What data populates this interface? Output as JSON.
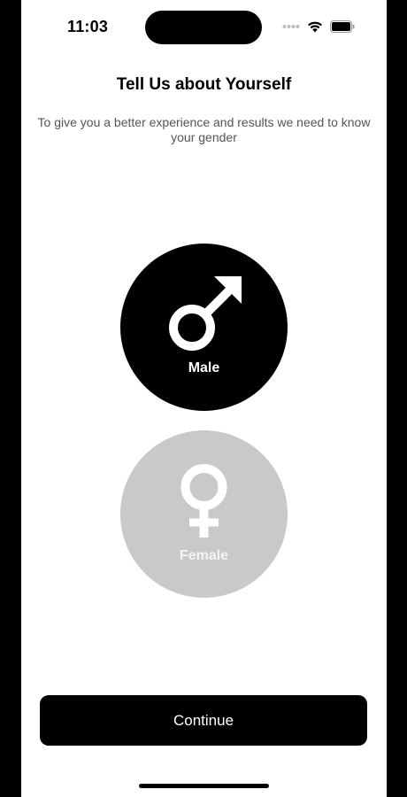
{
  "status_bar": {
    "time": "11:03",
    "icons": [
      "signal-dots-icon",
      "wifi-icon",
      "battery-icon"
    ]
  },
  "header": {
    "title": "Tell Us about Yourself",
    "subtitle": "To give you a better experience and results we need to know your gender"
  },
  "gender_options": [
    {
      "label": "Male",
      "icon": "male-symbol-icon",
      "selected": true,
      "color": "#000000"
    },
    {
      "label": "Female",
      "icon": "female-symbol-icon",
      "selected": false,
      "color": "#c9c9c9"
    }
  ],
  "continue_button": {
    "label": "Continue"
  }
}
